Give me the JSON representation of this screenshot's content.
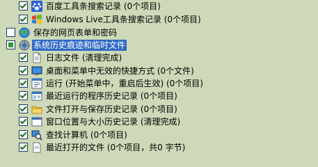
{
  "tree": {
    "items": [
      {
        "label": "百度工具条搜索记录 (0个项目)",
        "state": "checked",
        "icon": "baidu-paw-icon"
      },
      {
        "label": "Windows Live工具条搜索记录 (0个项目)",
        "state": "checked",
        "icon": "windows-flag-icon"
      },
      {
        "label": "保存的网页表单和密码",
        "state": "unchecked",
        "icon": "globe-icon"
      },
      {
        "label": "系统历史痕迹和临时文件",
        "state": "partial",
        "icon": "gear-globe-icon",
        "selected": true
      },
      {
        "label": "日志文件 (清理完成)",
        "state": "checked",
        "icon": "document-icon"
      },
      {
        "label": "桌面和菜单中无效的快捷方式 (0个文件)",
        "state": "checked",
        "icon": "desktop-icon"
      },
      {
        "label": "运行 (开始菜单中，重启后生效) (0个项目)",
        "state": "checked",
        "icon": "run-icon"
      },
      {
        "label": "最近运行的程序历史记录 (0个项目)",
        "state": "checked",
        "icon": "program-icon"
      },
      {
        "label": "文件打开与保存历史记录 (0个项目)",
        "state": "checked",
        "icon": "folder-icon"
      },
      {
        "label": "窗口位置与大小历史记录 (清理完成)",
        "state": "checked",
        "icon": "window-icon"
      },
      {
        "label": "查找计算机 (0个项目)",
        "state": "checked",
        "icon": "search-computer-icon"
      },
      {
        "label": "最近打开的文件 (0个项目，共0 字节)",
        "state": "checked",
        "icon": "recent-file-icon"
      }
    ]
  }
}
